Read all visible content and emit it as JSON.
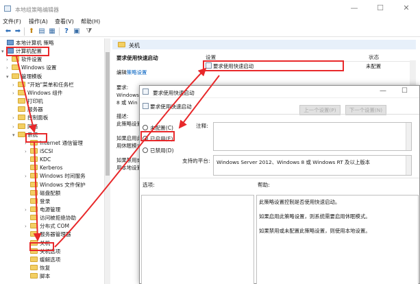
{
  "window": {
    "title": "本地组策略编辑器",
    "controls": {
      "minimize": "—",
      "maximize": "☐",
      "close": "✕"
    }
  },
  "menu": [
    "文件(F)",
    "操作(A)",
    "查看(V)",
    "帮助(H)"
  ],
  "toolbar_icons": [
    "back-icon",
    "forward-icon",
    "up-icon",
    "show-hide-tree-icon",
    "export-icon",
    "help-icon",
    "properties-icon",
    "filter-icon"
  ],
  "tree": [
    {
      "label": "本地计算机 策略",
      "level": 0,
      "twisty": "",
      "icon": "computer-icon",
      "highlighted": false
    },
    {
      "label": "计算机配置",
      "level": 0,
      "twisty": "▾",
      "icon": "computer-icon",
      "highlighted": true
    },
    {
      "label": "软件设置",
      "level": 1,
      "twisty": "›",
      "icon": "folder",
      "highlighted": false
    },
    {
      "label": "Windows 设置",
      "level": 1,
      "twisty": "›",
      "icon": "folder",
      "highlighted": false
    },
    {
      "label": "管理模板",
      "level": 1,
      "twisty": "▾",
      "icon": "folder",
      "highlighted": false
    },
    {
      "label": "\"开始\"菜单和任务栏",
      "level": 2,
      "twisty": "›",
      "icon": "folder",
      "highlighted": false
    },
    {
      "label": "Windows 组件",
      "level": 2,
      "twisty": "›",
      "icon": "folder",
      "highlighted": false
    },
    {
      "label": "打印机",
      "level": 2,
      "twisty": "",
      "icon": "folder",
      "highlighted": false
    },
    {
      "label": "服务器",
      "level": 2,
      "twisty": "",
      "icon": "folder",
      "highlighted": false
    },
    {
      "label": "控制面板",
      "level": 2,
      "twisty": "›",
      "icon": "folder",
      "highlighted": false
    },
    {
      "label": "网络",
      "level": 2,
      "twisty": "›",
      "icon": "folder",
      "highlighted": false
    },
    {
      "label": "系统",
      "level": 2,
      "twisty": "▾",
      "icon": "folder",
      "highlighted": true
    },
    {
      "label": "Internet 通信管理",
      "level": 3,
      "twisty": "›",
      "icon": "folder",
      "highlighted": false
    },
    {
      "label": "iSCSI",
      "level": 3,
      "twisty": "›",
      "icon": "folder",
      "highlighted": false
    },
    {
      "label": "KDC",
      "level": 3,
      "twisty": "",
      "icon": "folder",
      "highlighted": false
    },
    {
      "label": "Kerberos",
      "level": 3,
      "twisty": "",
      "icon": "folder",
      "highlighted": false
    },
    {
      "label": "Windows 时间服务",
      "level": 3,
      "twisty": "›",
      "icon": "folder",
      "highlighted": false
    },
    {
      "label": "Windows 文件保护",
      "level": 3,
      "twisty": "",
      "icon": "folder",
      "highlighted": false
    },
    {
      "label": "磁盘配额",
      "level": 3,
      "twisty": "",
      "icon": "folder",
      "highlighted": false
    },
    {
      "label": "登录",
      "level": 3,
      "twisty": "",
      "icon": "folder",
      "highlighted": false
    },
    {
      "label": "电源管理",
      "level": 3,
      "twisty": "›",
      "icon": "folder",
      "highlighted": false
    },
    {
      "label": "访问被拒绝协助",
      "level": 3,
      "twisty": "",
      "icon": "folder",
      "highlighted": false
    },
    {
      "label": "分布式 COM",
      "level": 3,
      "twisty": "›",
      "icon": "folder",
      "highlighted": false
    },
    {
      "label": "服务器管理器",
      "level": 3,
      "twisty": "",
      "icon": "folder",
      "highlighted": false
    },
    {
      "label": "关机",
      "level": 3,
      "twisty": "",
      "icon": "folder",
      "highlighted": true
    },
    {
      "label": "关机选项",
      "level": 3,
      "twisty": "",
      "icon": "folder",
      "highlighted": false
    },
    {
      "label": "缓解选项",
      "level": 3,
      "twisty": "",
      "icon": "folder",
      "highlighted": false
    },
    {
      "label": "恢复",
      "level": 3,
      "twisty": "",
      "icon": "folder",
      "highlighted": false
    },
    {
      "label": "脚本",
      "level": 3,
      "twisty": "",
      "icon": "folder",
      "highlighted": false
    }
  ],
  "rightpane": {
    "folder_title": "关机",
    "policy_title": "要求使用快速启动",
    "edit_prefix": "编辑",
    "edit_link": "策略设置",
    "req_label": "要求:",
    "req_lines": [
      "Windows",
      "8 或 Win"
    ],
    "desc_label": "描述:",
    "desc_lines": [
      "此策略设置",
      "",
      "如果启用此",
      "用休眠模式",
      "",
      "如果禁用或",
      "用本地设置"
    ],
    "columns": {
      "setting": "设置",
      "state": "状态"
    },
    "row": {
      "name": "要求使用快速启动",
      "state": "未配置"
    }
  },
  "dialog": {
    "title": "要求使用快速启动",
    "policy_name": "要求使用快速启动",
    "prev_button": "上一个设置(P)",
    "next_button": "下一个设置(N)",
    "radios": [
      {
        "label": "未配置(C)",
        "checked": false
      },
      {
        "label": "已启用(E)",
        "checked": true
      },
      {
        "label": "已禁用(D)",
        "checked": false
      }
    ],
    "comment_label": "注释:",
    "platform_label": "支持的平台:",
    "platform_value": "Windows Server 2012、Windows 8 或 Windows RT 及以上版本",
    "options_label": "选项:",
    "help_label": "帮助:",
    "help_lines": [
      "此策略设置控制是否使用快速启动。",
      "如果启用此策略设置，则系统需要启用休眠模式。",
      "如果禁用或未配置此策略设置，则使用本地设置。"
    ]
  },
  "annotation_color": "#e8282a"
}
